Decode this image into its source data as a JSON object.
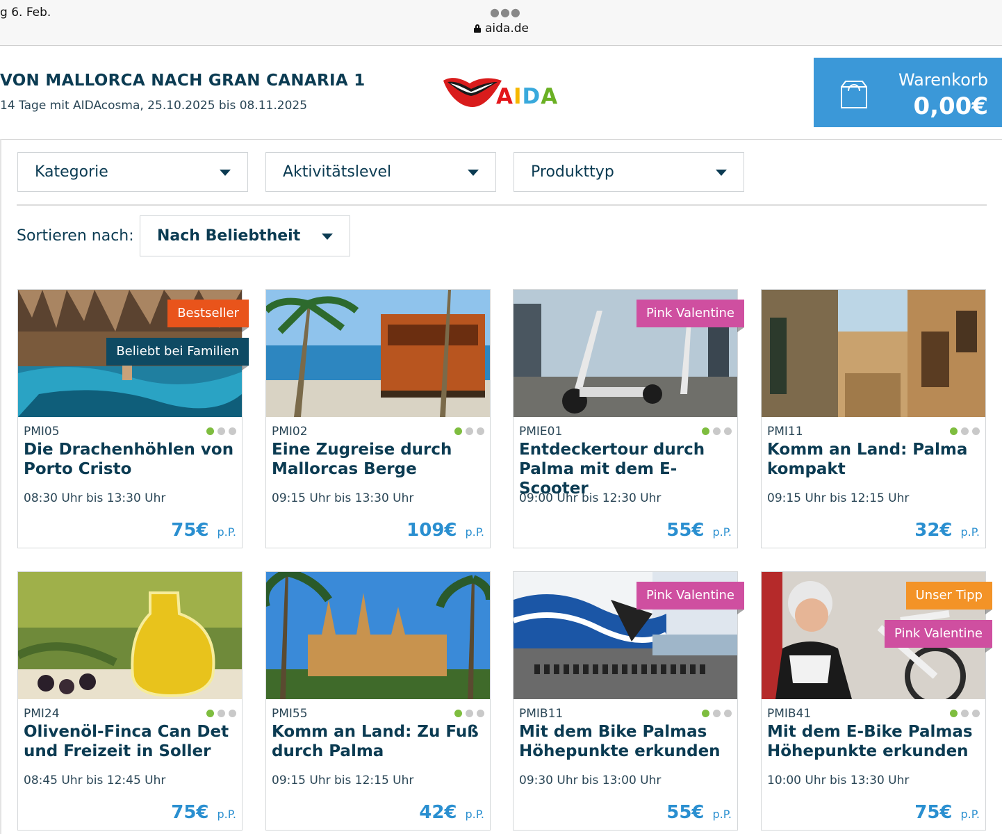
{
  "browser": {
    "status_date": "g 6. Feb.",
    "url": "aida.de"
  },
  "header": {
    "title": "VON MALLORCA NACH GRAN CANARIA 1",
    "subtitle": "14 Tage mit AIDAcosma, 25.10.2025 bis 08.11.2025",
    "logo_text": "AIDA",
    "logo_letter_colors": [
      "#e3161b",
      "#f6b800",
      "#39a9dc",
      "#6ab023"
    ],
    "cart": {
      "label": "Warenkorb",
      "amount": "0,00€"
    }
  },
  "filters": [
    {
      "label": "Kategorie"
    },
    {
      "label": "Aktivitätslevel"
    },
    {
      "label": "Produkttyp"
    }
  ],
  "sort": {
    "label": "Sortieren nach:",
    "value": "Nach Beliebtheit"
  },
  "colors": {
    "primary": "#0b3b52",
    "price": "#2a8fd0",
    "cart": "#3b98d8",
    "badge_bestseller": "#e9541b",
    "badge_family": "#0e4a63",
    "badge_pink": "#cf4fa0",
    "badge_tipp": "#f39327",
    "activity_on": "#7ebd3f"
  },
  "cards": [
    {
      "code": "PMI05",
      "title": "Die Drachenhöhlen von Porto Cristo",
      "time": "08:30 Uhr bis 13:30 Uhr",
      "price": "75€",
      "pp": "p.P.",
      "badges": [
        "Bestseller",
        "Beliebt bei Familien"
      ],
      "activity_level": 1
    },
    {
      "code": "PMI02",
      "title": "Eine Zugreise durch Mallorcas Berge",
      "time": "09:15 Uhr bis 13:30 Uhr",
      "price": "109€",
      "pp": "p.P.",
      "badges": [],
      "activity_level": 1
    },
    {
      "code": "PMIE01",
      "title": "Entdeckertour durch Palma mit dem E-Scooter",
      "time": "09:00 Uhr bis 12:30 Uhr",
      "price": "55€",
      "pp": "p.P.",
      "badges": [
        "Pink Valentine"
      ],
      "activity_level": 1
    },
    {
      "code": "PMI11",
      "title": "Komm an Land: Palma kompakt",
      "time": "09:15 Uhr bis 12:15 Uhr",
      "price": "32€",
      "pp": "p.P.",
      "badges": [],
      "activity_level": 1
    },
    {
      "code": "PMI24",
      "title": "Olivenöl-Finca Can Det und Freizeit in Soller",
      "time": "08:45 Uhr bis 12:45 Uhr",
      "price": "75€",
      "pp": "p.P.",
      "badges": [],
      "activity_level": 1
    },
    {
      "code": "PMI55",
      "title": "Komm an Land: Zu Fuß durch Palma",
      "time": "09:15 Uhr bis 12:15 Uhr",
      "price": "42€",
      "pp": "p.P.",
      "badges": [],
      "activity_level": 1
    },
    {
      "code": "PMIB11",
      "title": "Mit dem Bike Palmas Höhepunkte erkunden",
      "time": "09:30 Uhr bis 13:00 Uhr",
      "price": "55€",
      "pp": "p.P.",
      "badges": [
        "Pink Valentine"
      ],
      "activity_level": 1
    },
    {
      "code": "PMIB41",
      "title": "Mit dem E-Bike Palmas Höhepunkte erkunden",
      "time": "10:00 Uhr bis 13:30 Uhr",
      "price": "75€",
      "pp": "p.P.",
      "badges": [
        "Unser Tipp",
        "Pink Valentine"
      ],
      "activity_level": 1
    }
  ]
}
